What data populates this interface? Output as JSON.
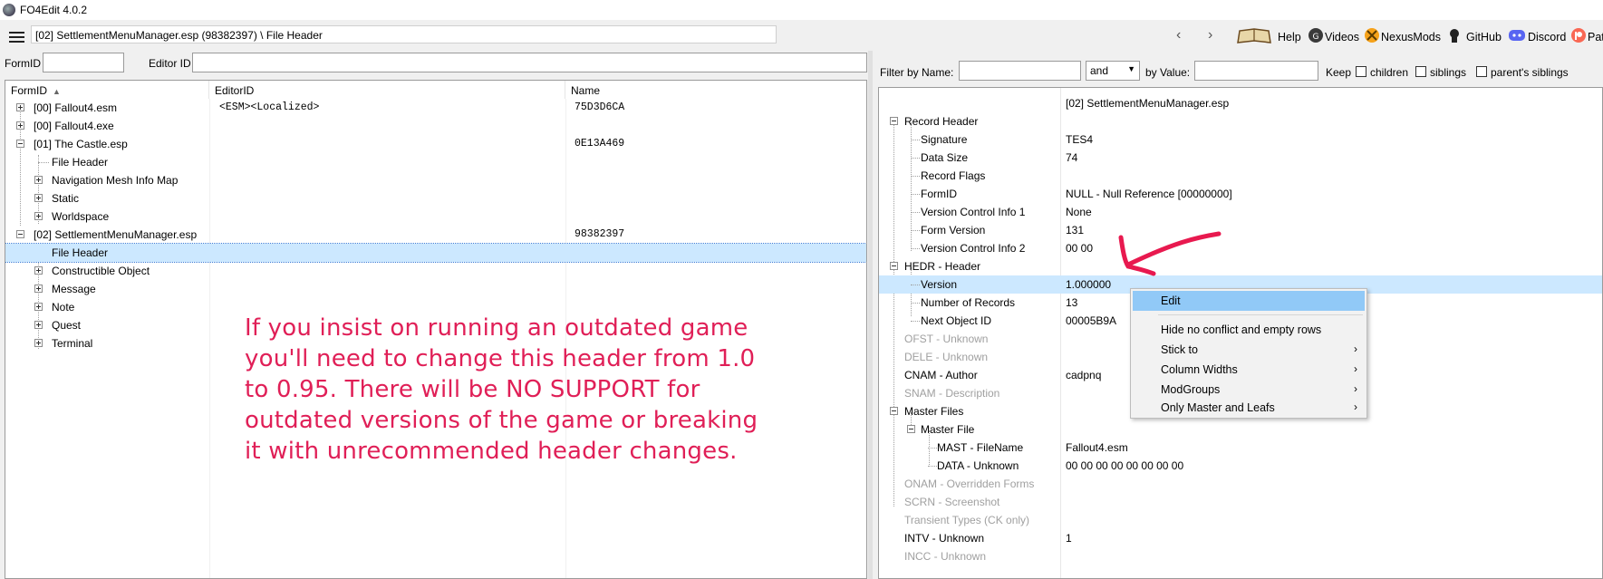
{
  "window": {
    "title": "FO4Edit 4.0.2"
  },
  "toolbar": {
    "path": "[02] SettlementMenuManager.esp (98382397) \\ File Header",
    "back_glyph": "‹",
    "forward_glyph": "›",
    "links": [
      {
        "label": "Help",
        "icon": "book-icon"
      },
      {
        "label": "Videos",
        "icon": "video-icon"
      },
      {
        "label": "NexusMods",
        "icon": "nexus-icon"
      },
      {
        "label": "GitHub",
        "icon": "github-icon"
      },
      {
        "label": "Discord",
        "icon": "discord-icon"
      },
      {
        "label": "Pat",
        "icon": "patreon-icon"
      }
    ]
  },
  "left": {
    "formid_label": "FormID",
    "editorid_label": "Editor ID",
    "columns": [
      "FormID",
      "EditorID",
      "Name"
    ],
    "rows": [
      {
        "label": "[00] Fallout4.esm",
        "editor": "<ESM><Localized>",
        "name": "75D3D6CA"
      },
      {
        "label": "[00] Fallout4.exe",
        "editor": "",
        "name": ""
      },
      {
        "label": "[01] The Castle.esp",
        "editor": "",
        "name": "0E13A469"
      },
      {
        "label": "File Header",
        "editor": "",
        "name": ""
      },
      {
        "label": "Navigation Mesh Info Map",
        "editor": "",
        "name": ""
      },
      {
        "label": "Static",
        "editor": "",
        "name": ""
      },
      {
        "label": "Worldspace",
        "editor": "",
        "name": ""
      },
      {
        "label": "[02] SettlementMenuManager.esp",
        "editor": "",
        "name": "98382397"
      },
      {
        "label": "File Header",
        "editor": "",
        "name": ""
      },
      {
        "label": "Constructible Object",
        "editor": "",
        "name": ""
      },
      {
        "label": "Message",
        "editor": "",
        "name": ""
      },
      {
        "label": "Note",
        "editor": "",
        "name": ""
      },
      {
        "label": "Quest",
        "editor": "",
        "name": ""
      },
      {
        "label": "Terminal",
        "editor": "",
        "name": ""
      }
    ],
    "annotation": [
      "If you insist on running an outdated game",
      "you'll need to change this header from 1.0",
      "to 0.95. There will be NO SUPPORT for",
      "outdated versions of the game or breaking",
      "it with unrecommended header changes."
    ]
  },
  "right": {
    "filter_name_label": "Filter by Name:",
    "and_value": "and",
    "by_value_label": "by Value:",
    "keep_label": "Keep",
    "children_label": "children",
    "siblings_label": "siblings",
    "parents_siblings_label": "parent's siblings",
    "header_file": "[02] SettlementMenuManager.esp",
    "rows": [
      {
        "label": "Record Header",
        "value": "",
        "gray": false
      },
      {
        "label": "Signature",
        "value": "TES4",
        "gray": false
      },
      {
        "label": "Data Size",
        "value": "74",
        "gray": false
      },
      {
        "label": "Record Flags",
        "value": "",
        "gray": false
      },
      {
        "label": "FormID",
        "value": "NULL - Null Reference [00000000]",
        "gray": false
      },
      {
        "label": "Version Control Info 1",
        "value": "None",
        "gray": false
      },
      {
        "label": "Form Version",
        "value": "131",
        "gray": false
      },
      {
        "label": "Version Control Info 2",
        "value": "00 00",
        "gray": false
      },
      {
        "label": "HEDR - Header",
        "value": "",
        "gray": false
      },
      {
        "label": "Version",
        "value": "1.000000",
        "gray": false
      },
      {
        "label": "Number of Records",
        "value": "13",
        "gray": false
      },
      {
        "label": "Next Object ID",
        "value": "00005B9A",
        "gray": false
      },
      {
        "label": "OFST - Unknown",
        "value": "",
        "gray": true
      },
      {
        "label": "DELE - Unknown",
        "value": "",
        "gray": true
      },
      {
        "label": "CNAM - Author",
        "value": "cadpnq",
        "gray": false
      },
      {
        "label": "SNAM - Description",
        "value": "",
        "gray": true
      },
      {
        "label": "Master Files",
        "value": "",
        "gray": false
      },
      {
        "label": "Master File",
        "value": "",
        "gray": false
      },
      {
        "label": "MAST - FileName",
        "value": "Fallout4.esm",
        "gray": false
      },
      {
        "label": "DATA - Unknown",
        "value": "00 00 00 00 00 00 00 00",
        "gray": false
      },
      {
        "label": "ONAM - Overridden Forms",
        "value": "",
        "gray": true
      },
      {
        "label": "SCRN - Screenshot",
        "value": "",
        "gray": true
      },
      {
        "label": "Transient Types (CK only)",
        "value": "",
        "gray": true
      },
      {
        "label": "INTV - Unknown",
        "value": "1",
        "gray": false
      },
      {
        "label": "INCC - Unknown",
        "value": "",
        "gray": true
      }
    ]
  },
  "context_menu": {
    "items": [
      {
        "label": "Edit",
        "submenu": false
      },
      {
        "label": "Hide no conflict and empty rows",
        "submenu": false
      },
      {
        "label": "Stick to",
        "submenu": true
      },
      {
        "label": "Column Widths",
        "submenu": true
      },
      {
        "label": "ModGroups",
        "submenu": true
      },
      {
        "label": "Only Master and Leafs",
        "submenu": true
      }
    ],
    "submenu_glyph": "›"
  },
  "colors": {
    "selection": "#cce8ff",
    "menu_highlight": "#91c9f7",
    "annotation": "#e01f57",
    "arrow": "#e8194f"
  }
}
